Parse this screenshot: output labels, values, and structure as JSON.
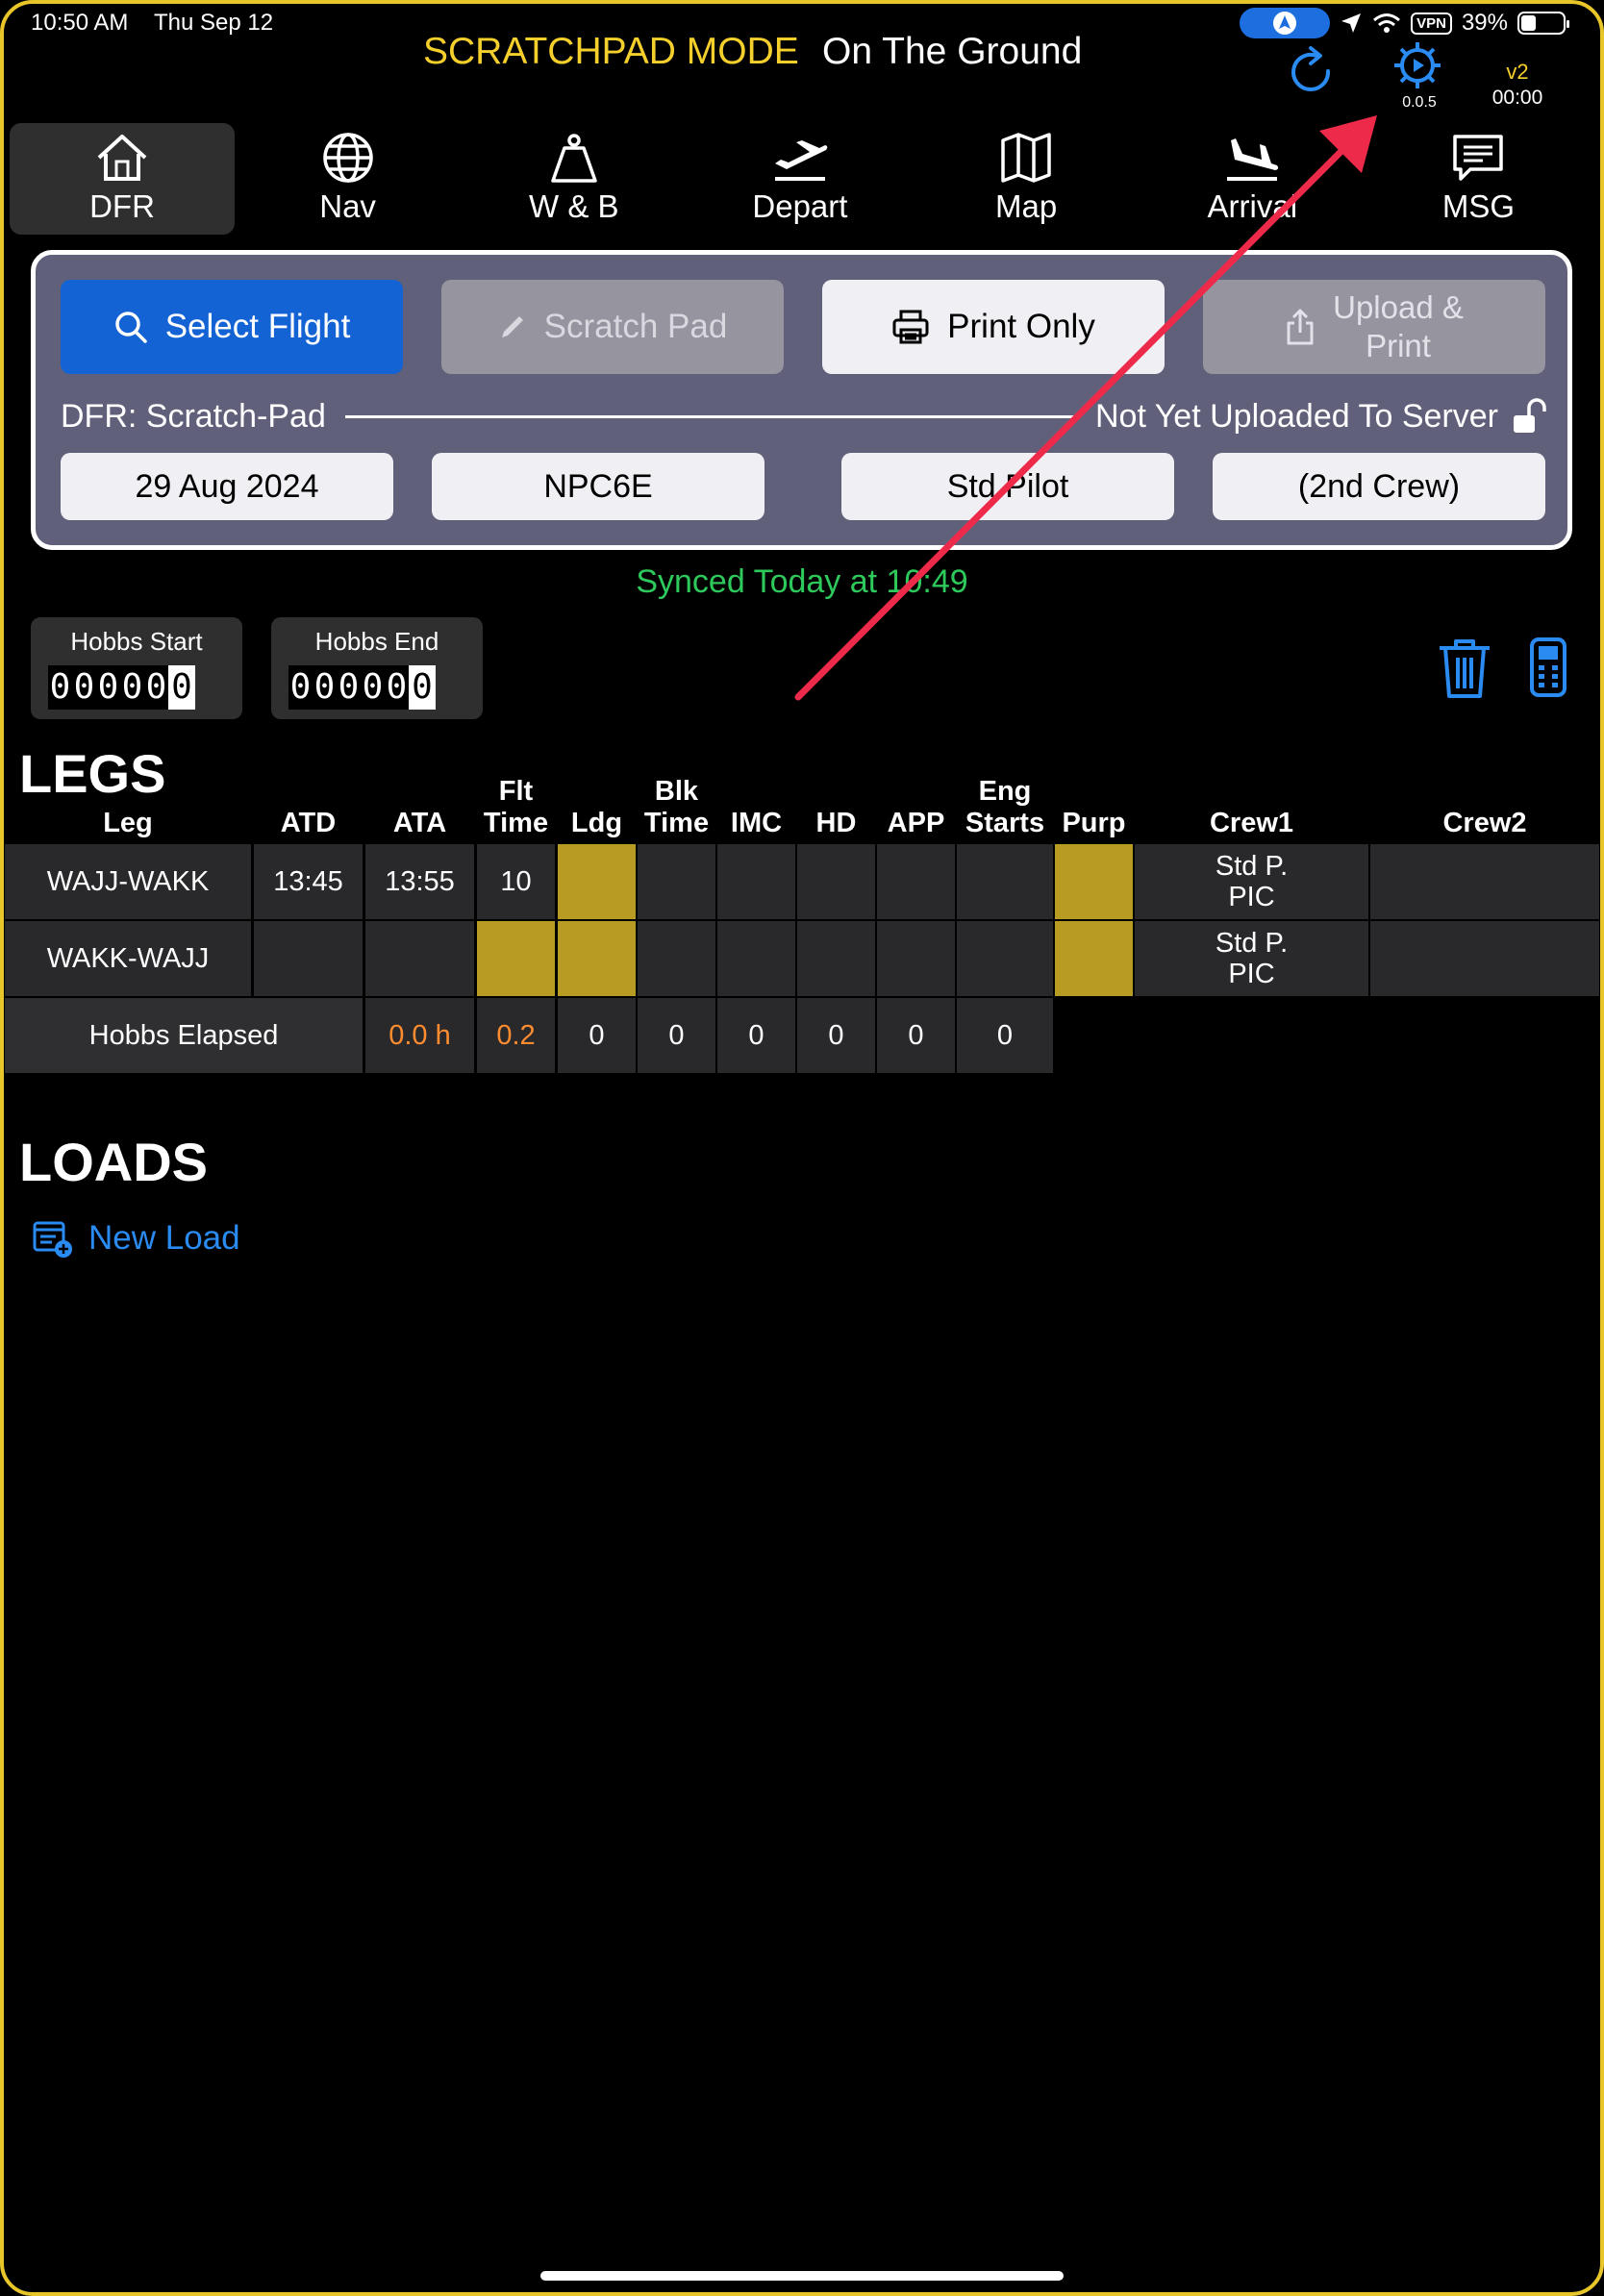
{
  "status_bar": {
    "time": "10:50 AM",
    "date": "Thu Sep 12",
    "vpn": "VPN",
    "battery": "39%"
  },
  "header": {
    "mode": "SCRATCHPAD MODE",
    "state": "On The Ground",
    "gear_version": "0.0.5",
    "version": "v2",
    "timer": "00:00"
  },
  "nav": [
    {
      "label": "DFR",
      "icon": "house-icon"
    },
    {
      "label": "Nav",
      "icon": "globe-icon"
    },
    {
      "label": "W & B",
      "icon": "weight-icon"
    },
    {
      "label": "Depart",
      "icon": "plane-departure-icon"
    },
    {
      "label": "Map",
      "icon": "map-icon"
    },
    {
      "label": "Arrival",
      "icon": "plane-arrival-icon"
    },
    {
      "label": "MSG",
      "icon": "message-icon"
    }
  ],
  "panel": {
    "select_flight": "Select Flight",
    "scratch_pad": "Scratch Pad",
    "print_only": "Print Only",
    "upload_line1": "Upload &",
    "upload_line2": "Print",
    "dfr_label": "DFR: Scratch-Pad",
    "upload_status": "Not Yet Uploaded To Server",
    "date": "29 Aug 2024",
    "aircraft": "NPC6E",
    "pilot": "Std Pilot",
    "crew2": "(2nd Crew)"
  },
  "synced": "Synced Today at 10:49",
  "hobbs": {
    "start_label": "Hobbs Start",
    "end_label": "Hobbs End",
    "start_digits": [
      "0",
      "0",
      "0",
      "0",
      "0",
      "0"
    ],
    "end_digits": [
      "0",
      "0",
      "0",
      "0",
      "0",
      "0"
    ]
  },
  "legs": {
    "title": "LEGS",
    "headers": {
      "leg": "Leg",
      "atd": "ATD",
      "ata": "ATA",
      "flt1": "Flt",
      "flt2": "Time",
      "ldg": "Ldg",
      "blk1": "Blk",
      "blk2": "Time",
      "imc": "IMC",
      "hd": "HD",
      "app": "APP",
      "eng1": "Eng",
      "eng2": "Starts",
      "purp": "Purp",
      "crew1": "Crew1",
      "crew2": "Crew2"
    },
    "rows": [
      {
        "leg": "WAJJ-WAKK",
        "atd": "13:45",
        "ata": "13:55",
        "flt": "10",
        "crew1_a": "Std P.",
        "crew1_b": "PIC"
      },
      {
        "leg": "WAKK-WAJJ",
        "atd": "",
        "ata": "",
        "flt": "",
        "crew1_a": "Std P.",
        "crew1_b": "PIC"
      }
    ],
    "totals": {
      "label": "Hobbs Elapsed",
      "ata": "0.0 h",
      "flt": "0.2",
      "ldg": "0",
      "blk": "0",
      "imc": "0",
      "hd": "0",
      "app": "0",
      "eng": "0"
    }
  },
  "loads": {
    "title": "LOADS",
    "new_load": "New Load"
  },
  "colors": {
    "accent_yellow": "#f5cf2c",
    "brand_blue": "#1463d5",
    "sync_green": "#2ec95b",
    "gold_cell": "#b89b22",
    "annotation_red": "#ee2a4a"
  }
}
